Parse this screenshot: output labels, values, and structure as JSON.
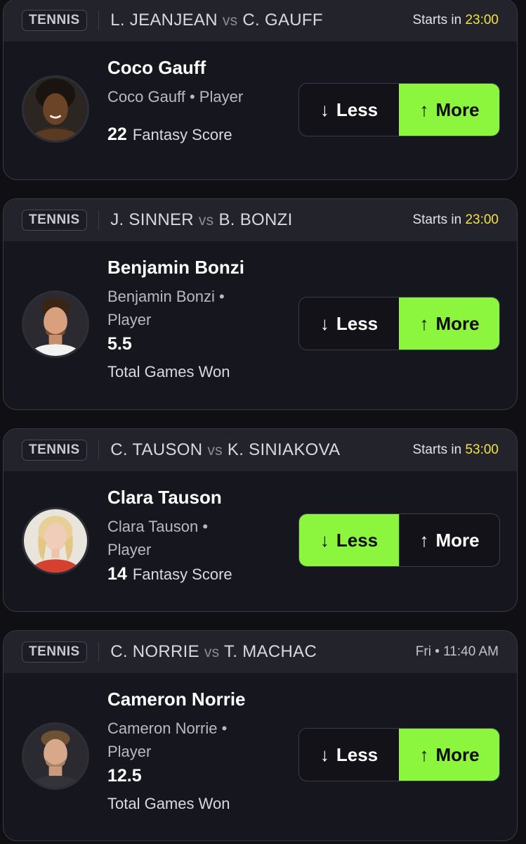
{
  "cards": [
    {
      "sport": "TENNIS",
      "team_a": "L. JEANJEAN",
      "vs": "vs",
      "team_b": "C. GAUFF",
      "time_prefix": "Starts in",
      "time_value": "23:00",
      "player_name": "Coco Gauff",
      "player_sub": "Coco Gauff • Player",
      "line": "22",
      "stat": "Fantasy Score",
      "less_label": "Less",
      "more_label": "More",
      "selected": "more"
    },
    {
      "sport": "TENNIS",
      "team_a": "J. SINNER",
      "vs": "vs",
      "team_b": "B. BONZI",
      "time_prefix": "Starts in",
      "time_value": "23:00",
      "player_name": "Benjamin Bonzi",
      "player_sub_1": "Benjamin Bonzi •",
      "player_sub_2": "Player",
      "line": "5.5",
      "stat": "Total Games Won",
      "less_label": "Less",
      "more_label": "More",
      "selected": "more"
    },
    {
      "sport": "TENNIS",
      "team_a": "C. TAUSON",
      "vs": "vs",
      "team_b": "K. SINIAKOVA",
      "time_prefix": "Starts in",
      "time_value": "53:00",
      "player_name": "Clara Tauson",
      "player_sub_1": "Clara Tauson •",
      "player_sub_2": "Player",
      "line": "14",
      "stat": "Fantasy Score",
      "less_label": "Less",
      "more_label": "More",
      "selected": "less"
    },
    {
      "sport": "TENNIS",
      "team_a": "C. NORRIE",
      "vs": "vs",
      "team_b": "T. MACHAC",
      "time_full": "Fri • 11:40 AM",
      "player_name": "Cameron Norrie",
      "player_sub_1": "Cameron Norrie •",
      "player_sub_2": "Player",
      "line": "12.5",
      "stat": "Total Games Won",
      "less_label": "Less",
      "more_label": "More",
      "selected": "more"
    }
  ],
  "icons": {
    "down_arrow": "arrow-down-icon",
    "up_arrow": "arrow-up-icon"
  },
  "colors": {
    "selected": "#8cf53e",
    "countdown": "#f3e24a",
    "card_bg": "#16161e",
    "header_bg": "#23232c"
  }
}
